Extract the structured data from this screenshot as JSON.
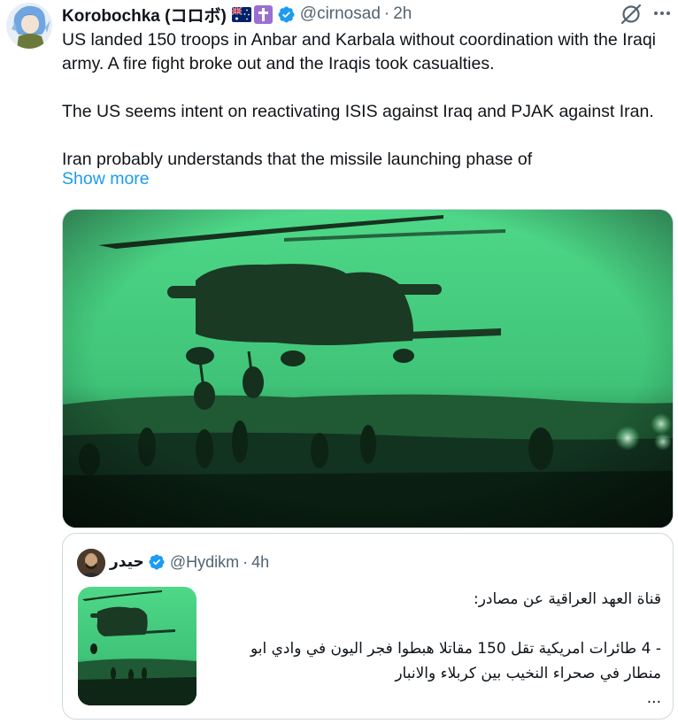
{
  "tweet": {
    "display_name": "Korobochka (コロボ)",
    "flag_icon": "australia-flag-icon",
    "badge_icon": "latin-cross-icon",
    "verified_icon": "verified-badge-icon",
    "handle": "@cirnosad",
    "separator": "·",
    "time": "2h",
    "paragraphs": [
      "US landed 150 troops in Anbar and Karbala without coordination with the Iraqi army. A fire fight broke out and the Iraqis took casualties.",
      "The US seems intent on reactivating ISIS against Iraq and PJAK against Iran.",
      "Iran probably understands that the missile launching phase of"
    ],
    "show_more": "Show more",
    "actions": {
      "grok_icon": "grok-slash-icon",
      "more_icon": "more-dots-icon"
    }
  },
  "quote": {
    "display_name": "حيدر",
    "verified_icon": "verified-badge-icon",
    "handle": "@Hydikm",
    "separator": "·",
    "time": "4h",
    "lines": [
      "قناة العهد العراقية عن مصادر:",
      "",
      "- 4 طائرات امريكية تقل 150 مقاتلا هبطوا فجر اليون في وادي ابو",
      "منطار في صحراء النخيب بين كربلاء والانبار",
      "..."
    ]
  },
  "colors": {
    "accent": "#1d9bf0",
    "text": "#0f1419",
    "secondary": "#536471",
    "border": "#cfd9de",
    "night_vision_green": "#3bd47a"
  }
}
